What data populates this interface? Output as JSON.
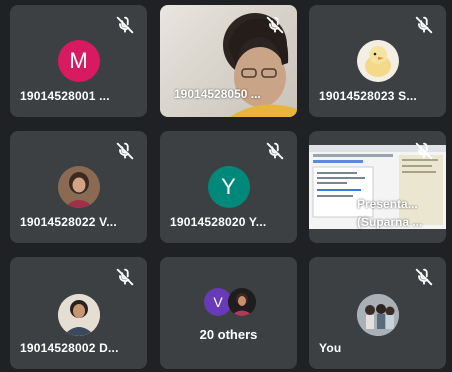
{
  "participants": [
    {
      "name": "19014528001 ...",
      "initial": "M",
      "color": "#d81b60"
    },
    {
      "name": "19014528050 ..."
    },
    {
      "name": "19014528023 S..."
    },
    {
      "name": "19014528022 V..."
    },
    {
      "name": "19014528020 Y...",
      "initial": "Y",
      "color": "#00897b"
    },
    {
      "presentation_line1": "Presenta...",
      "presentation_line2": "(Suparna ..."
    },
    {
      "name": "19014528002 D..."
    },
    {
      "others_initial": "V",
      "others_color": "#673ab7",
      "others_label": "20 others"
    },
    {
      "name": "You"
    }
  ],
  "icons": {
    "muted": "mic-off-icon"
  }
}
